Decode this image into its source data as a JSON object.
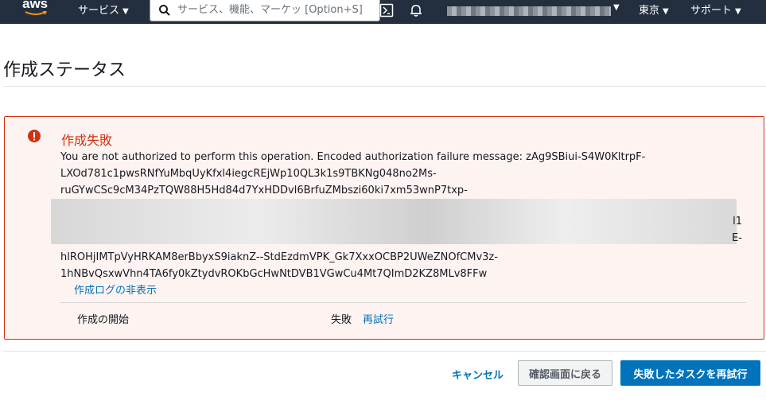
{
  "nav": {
    "logo": "aws",
    "services_label": "サービス",
    "search_placeholder": "サービス、機能、マーケッ [Option+S]",
    "region_label": "東京",
    "support_label": "サポート",
    "icons": [
      "search-icon",
      "cloudshell-icon",
      "bell-icon",
      "chevron-down-icon"
    ]
  },
  "page": {
    "title": "作成ステータス"
  },
  "alert": {
    "title": "作成失敗",
    "message_lines": [
      "You are not authorized to perform this operation. Encoded authorization failure message: zAg9SBiui-S4W0KltrpF-",
      "LXOd781c1pwsRNfYuMbqUyKfxl4iegcREjWp10QL3k1s9TBKNg048no2Ms-",
      "ruGYwCSc9cM34PzTQW88H5Hd84d7YxHDDvl6BrfuZMbszi60ki7xm53wnP7txp-"
    ],
    "blurred_tail_1": "l1",
    "blurred_tail_2": "E-",
    "message_lines_after": [
      "hlROHjIMTpVyHRKAM8erBbyxS9iaknZ--StdEzdmVPK_Gk7XxxOCBP2UWeZNOfCMv3z-",
      "1hNBvQsxwVhn4TA6fy0kZtydvROKbGcHwNtDVB1VGwCu4Mt7QImD2KZ8MLv8FFw"
    ],
    "hide_log_label": "作成ログの非表示",
    "step_label": "作成の開始",
    "step_status": "失敗",
    "retry_label": "再試行"
  },
  "footer": {
    "cancel_label": "キャンセル",
    "back_label": "確認画面に戻る",
    "retry_task_label": "失敗したタスクを再試行"
  },
  "colors": {
    "nav_bg": "#232f3e",
    "error": "#d13212",
    "link": "#0073bb",
    "primary": "#0073bb"
  }
}
